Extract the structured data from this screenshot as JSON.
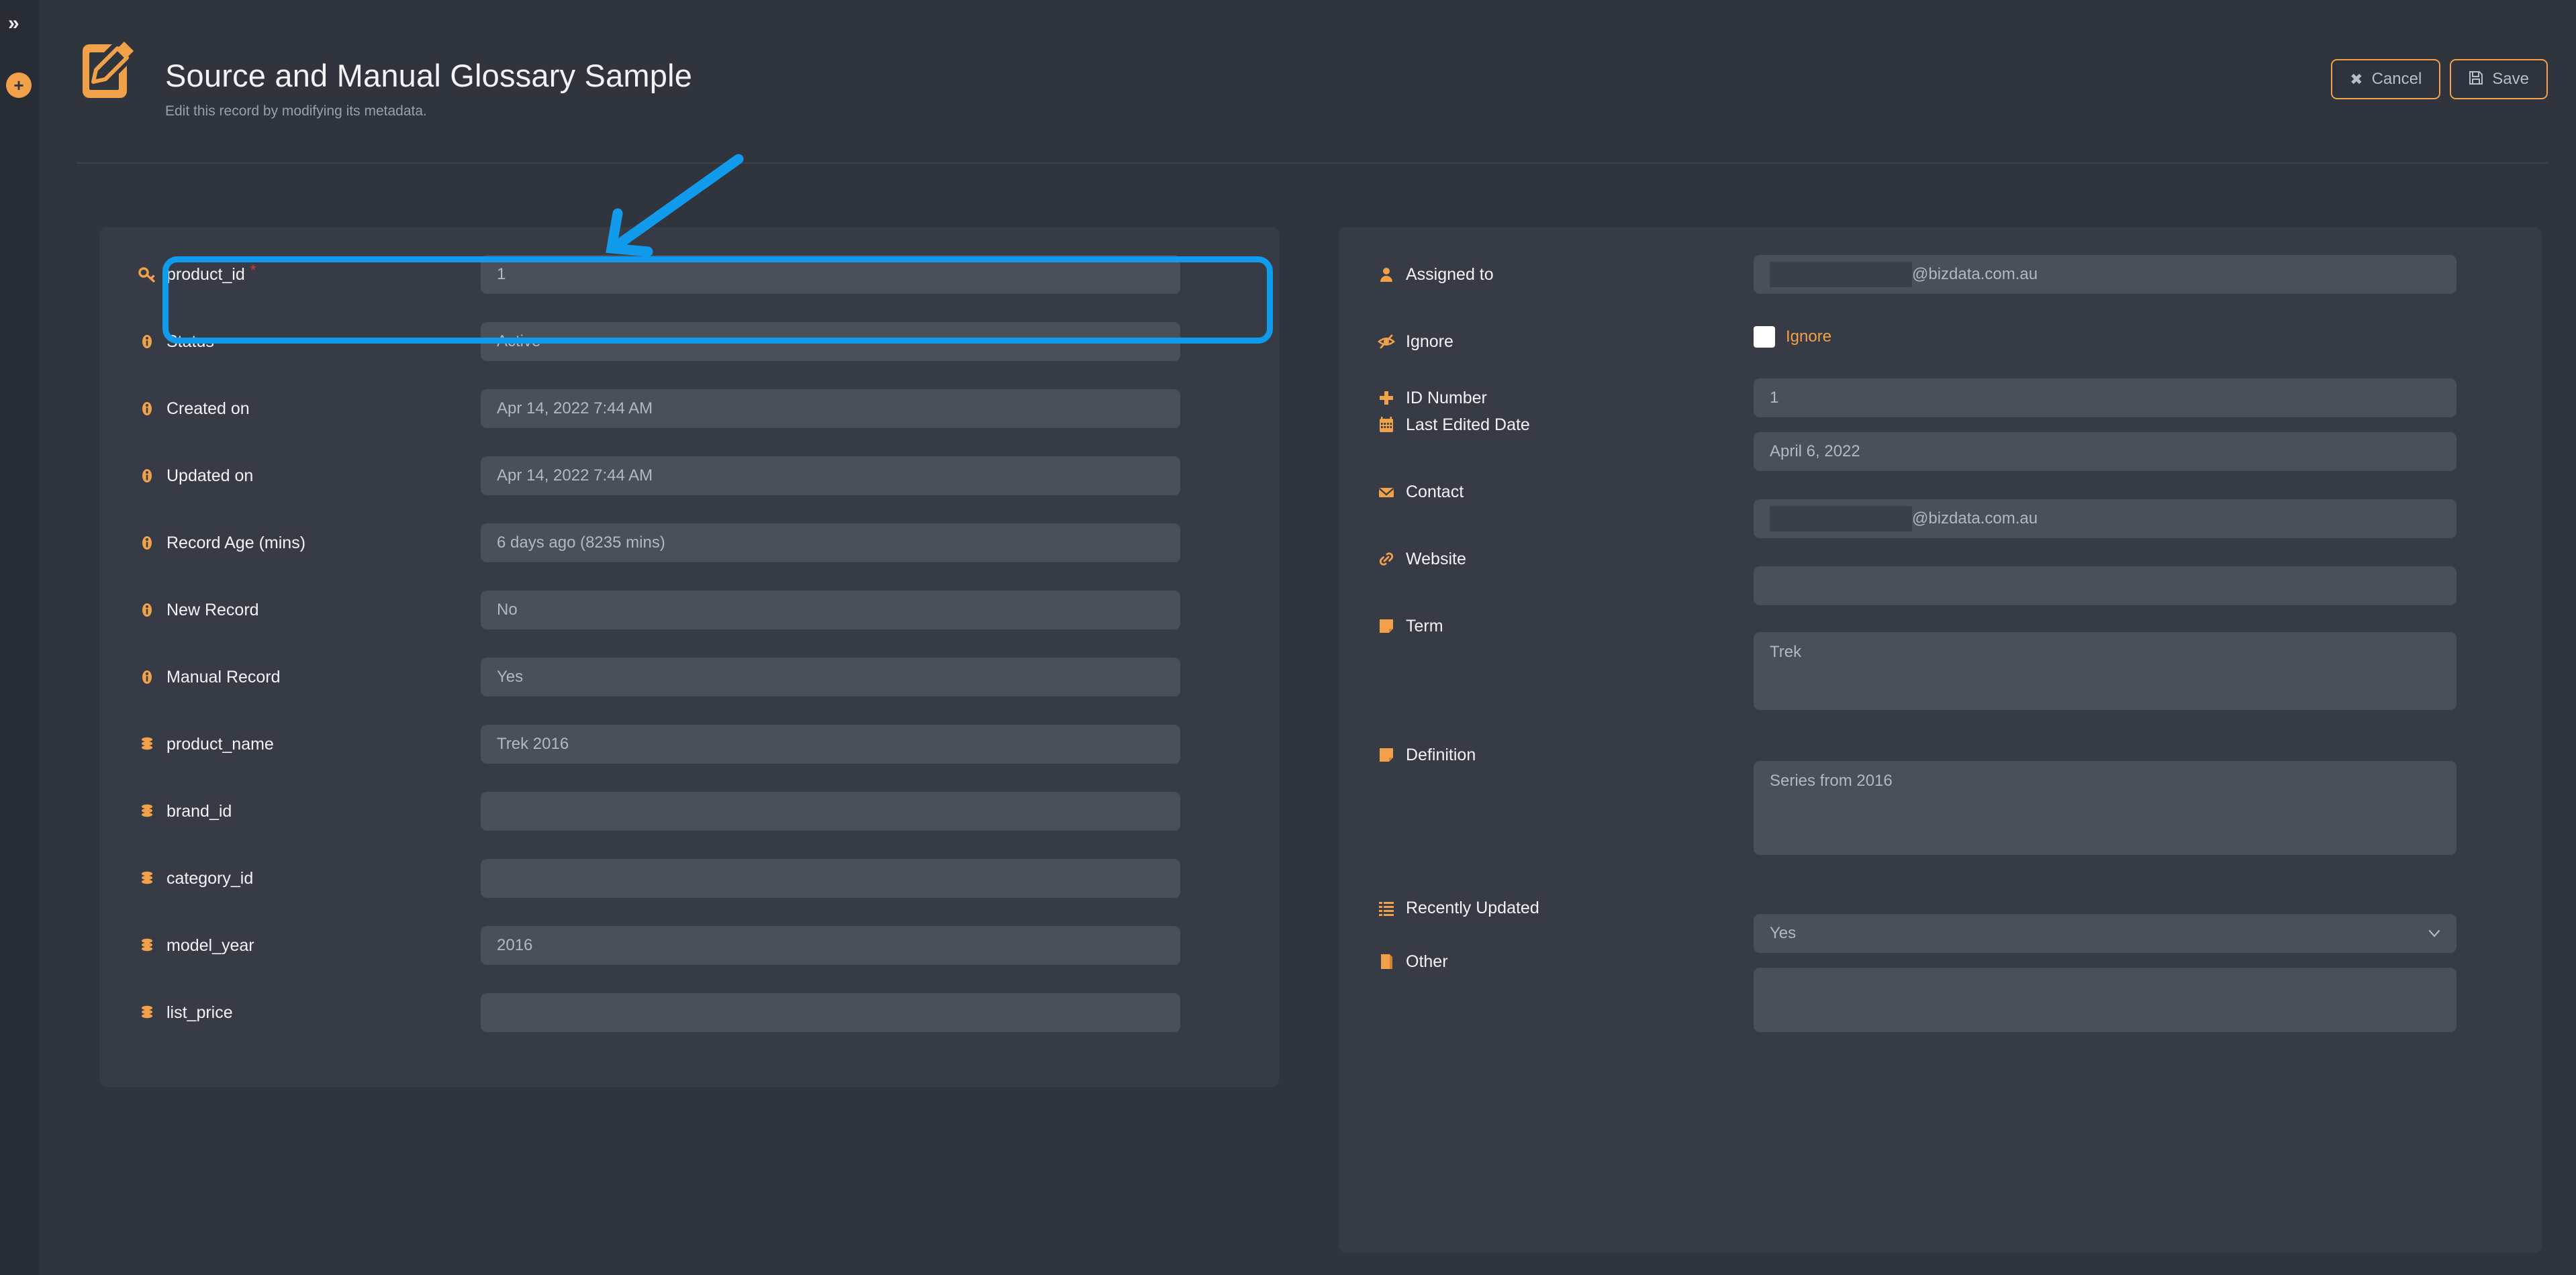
{
  "rail": {
    "expand_icon": "double-chevron-right-icon",
    "expand_label": "»",
    "add_label": "+"
  },
  "header": {
    "icon": "edit-document-icon",
    "title": "Source and Manual Glossary Sample",
    "subtitle": "Edit this record by modifying its metadata.",
    "buttons": [
      {
        "name": "cancel-button",
        "glyph": "✖",
        "label": "Cancel"
      },
      {
        "name": "save-button",
        "glyph": "💾",
        "label": "Save"
      }
    ]
  },
  "annotation": {
    "color": "#119bed",
    "arrow": "arrow-pointing-to-product-id-field",
    "highlight_target": "product_id"
  },
  "left_panel": {
    "fields": [
      {
        "icon": "key-icon",
        "label": "product_id",
        "required": true,
        "value": "1"
      },
      {
        "icon": "info-icon",
        "label": "Status",
        "required": false,
        "value": "Active"
      },
      {
        "icon": "info-icon",
        "label": "Created on",
        "required": false,
        "value": "Apr 14, 2022 7:44 AM"
      },
      {
        "icon": "info-icon",
        "label": "Updated on",
        "required": false,
        "value": "Apr 14, 2022 7:44 AM"
      },
      {
        "icon": "info-icon",
        "label": "Record Age (mins)",
        "required": false,
        "value": "6 days ago (8235 mins)"
      },
      {
        "icon": "info-icon",
        "label": "New Record",
        "required": false,
        "value": "No"
      },
      {
        "icon": "info-icon",
        "label": "Manual Record",
        "required": false,
        "value": "Yes"
      },
      {
        "icon": "database-icon",
        "label": "product_name",
        "required": false,
        "value": "Trek 2016"
      },
      {
        "icon": "database-icon",
        "label": "brand_id",
        "required": false,
        "value": ""
      },
      {
        "icon": "database-icon",
        "label": "category_id",
        "required": false,
        "value": ""
      },
      {
        "icon": "database-icon",
        "label": "model_year",
        "required": false,
        "value": "2016"
      },
      {
        "icon": "database-icon",
        "label": "list_price",
        "required": false,
        "value": ""
      }
    ]
  },
  "right_panel": {
    "assigned_to": {
      "icon": "user-icon",
      "label": "Assigned to",
      "value_redacted": true,
      "value_suffix": "@bizdata.com.au"
    },
    "ignore": {
      "icon": "eye-slash-icon",
      "label": "Ignore",
      "checkbox_label": "Ignore",
      "checked": false
    },
    "id_number": {
      "icon": "plus-icon",
      "label": "ID Number",
      "value": "1"
    },
    "last_edited_date": {
      "icon": "calendar-icon",
      "label": "Last Edited Date",
      "value": "April 6, 2022"
    },
    "contact": {
      "icon": "envelope-icon",
      "label": "Contact",
      "value_redacted": true,
      "value_suffix": "@bizdata.com.au"
    },
    "website": {
      "icon": "link-icon",
      "label": "Website",
      "value": ""
    },
    "term": {
      "icon": "note-icon",
      "label": "Term",
      "value": "Trek"
    },
    "definition": {
      "icon": "note-icon",
      "label": "Definition",
      "value": "Series from 2016"
    },
    "recently_updated": {
      "icon": "list-icon",
      "label": "Recently Updated",
      "value": "Yes",
      "caret": "chevron-down-icon"
    },
    "other": {
      "icon": "note-blank-icon",
      "label": "Other",
      "value": ""
    }
  },
  "colors": {
    "accent": "#f0a14a",
    "annotation": "#119bed",
    "required": "#e0383a",
    "page_bg": "#30343d",
    "panel_bg": "#373b45",
    "control_bg": "#4a4f5a"
  }
}
